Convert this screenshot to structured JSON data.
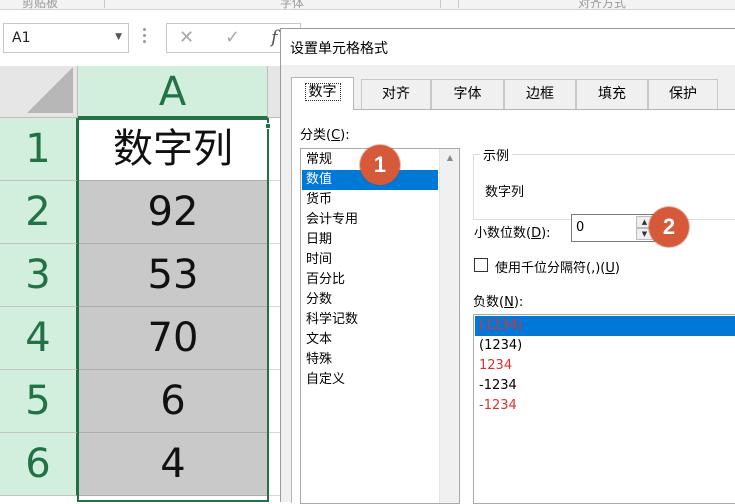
{
  "ribbon": {
    "groups": [
      "剪贴板",
      "字体",
      "对齐方式"
    ]
  },
  "formula_bar": {
    "name_box": "A1",
    "cancel_icon": "close-icon",
    "enter_icon": "check-icon",
    "function_icon": "fx-icon",
    "fx_text": "f"
  },
  "sheet": {
    "column_header": "A",
    "rows": [
      {
        "row": "1",
        "value": "数字列"
      },
      {
        "row": "2",
        "value": "92"
      },
      {
        "row": "3",
        "value": "53"
      },
      {
        "row": "4",
        "value": "70"
      },
      {
        "row": "5",
        "value": "6"
      },
      {
        "row": "6",
        "value": "4"
      }
    ]
  },
  "dialog": {
    "title": "设置单元格格式",
    "tabs": [
      "数字",
      "对齐",
      "字体",
      "边框",
      "填充",
      "保护"
    ],
    "active_tab": "数字",
    "category_label": "分类(C):",
    "categories": [
      "常规",
      "数值",
      "货币",
      "会计专用",
      "日期",
      "时间",
      "百分比",
      "分数",
      "科学记数",
      "文本",
      "特殊",
      "自定义"
    ],
    "selected_category": "数值",
    "sample_label": "示例",
    "sample_value": "数字列",
    "decimal_label": "小数位数(D):",
    "decimal_value": "0",
    "separator_label": "使用千位分隔符(,)(U)",
    "separator_checked": false,
    "negative_label": "负数(N):",
    "negative_formats": [
      {
        "text": "(1234)",
        "color": "#e0302c"
      },
      {
        "text": "(1234)",
        "color": "#000000"
      },
      {
        "text": "1234",
        "color": "#e0302c"
      },
      {
        "text": "-1234",
        "color": "#000000"
      },
      {
        "text": "-1234",
        "color": "#e0302c"
      }
    ]
  },
  "callouts": [
    "1",
    "2"
  ],
  "colors": {
    "excel_green": "#217346",
    "header_highlight": "#d2eedc",
    "selection_blue": "#0078d7",
    "callout": "#d65a3a",
    "negative_red": "#e0302c"
  }
}
